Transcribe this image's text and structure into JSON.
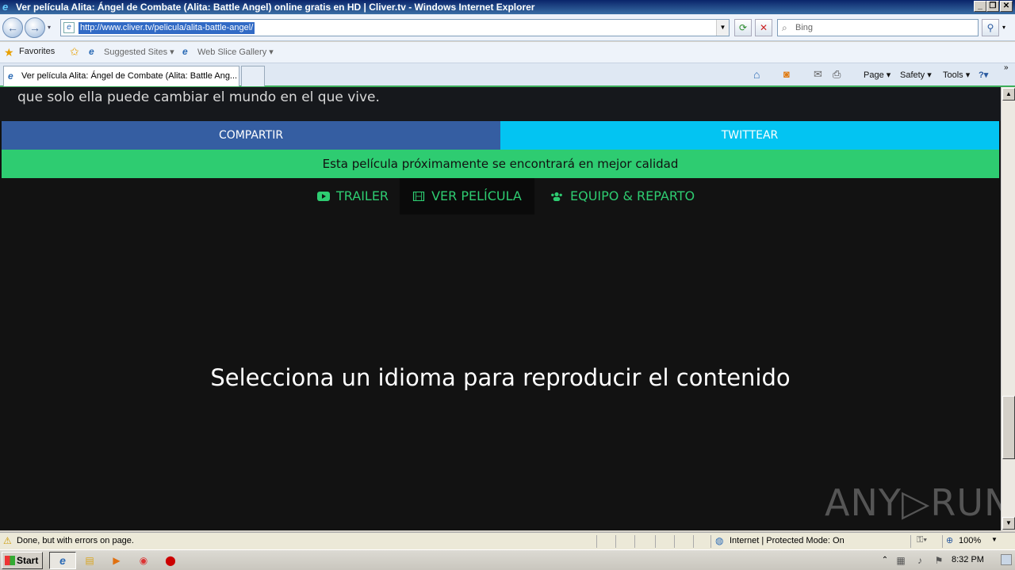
{
  "window": {
    "title": "Ver película Alita: Ángel de Combate (Alita: Battle Angel) online gratis en HD | Cliver.tv - Windows Internet Explorer",
    "min": "_",
    "restore": "❐",
    "close": "✕"
  },
  "nav": {
    "back_glyph": "←",
    "forward_glyph": "→",
    "url": "http://www.cliver.tv/pelicula/alita-battle-angel/",
    "refresh_glyph": "⟳",
    "stop_glyph": "✕",
    "search_placeholder": "Bing",
    "search_glyph": "⚲"
  },
  "favorites": {
    "favorites_label": "Favorites",
    "suggested_sites": "Suggested Sites ▾",
    "web_slice_gallery": "Web Slice Gallery ▾"
  },
  "tabs": {
    "active_tab": "Ver película Alita: Ángel de Combate (Alita: Battle Ang...",
    "commands": {
      "page": "Page ▾",
      "safety": "Safety ▾",
      "tools": "Tools ▾",
      "help": "?▾"
    }
  },
  "page": {
    "synopsis_tail": "que solo ella puede cambiar el mundo en el que vive.",
    "share_button": "COMPARTIR",
    "tweet_button": "TWITTEAR",
    "quality_notice": "Esta película próximamente se encontrará en mejor calidad",
    "tab_trailer": "TRAILER",
    "tab_watch": "VER PELÍCULA",
    "tab_cast": "EQUIPO & REPARTO",
    "player_message": "Selecciona un idioma para reproducir el contenido",
    "watermark": "ANY▷RUN",
    "colors": {
      "share": "#355ea2",
      "tweet": "#03c4f2",
      "accent": "#2ecc71",
      "background": "#121212"
    }
  },
  "status": {
    "text": "Done, but with errors on page.",
    "zone": "Internet | Protected Mode: On",
    "zoom": "100%"
  },
  "taskbar": {
    "start": "Start",
    "clock": "8:32 PM"
  }
}
